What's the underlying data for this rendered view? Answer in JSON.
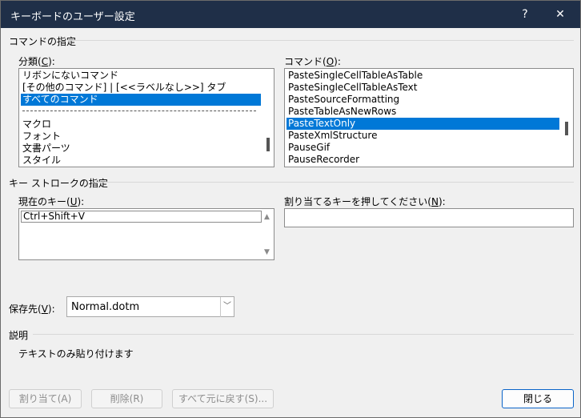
{
  "title": "キーボードのユーザー設定",
  "titlebar": {
    "help_label": "?",
    "close_label": "✕"
  },
  "command_group": "コマンドの指定",
  "categories": {
    "label_pre": "分類(",
    "label_key": "C",
    "label_post": "):",
    "items": [
      "リボンにないコマンド",
      "[その他のコマンド] | [<<ラベルなし>>] タブ",
      "すべてのコマンド",
      "マクロ",
      "フォント",
      "文書パーツ",
      "スタイル"
    ],
    "selected_index": 2
  },
  "commands": {
    "label_pre": "コマンド(",
    "label_key": "O",
    "label_post": "):",
    "items": [
      "PasteSingleCellTableAsTable",
      "PasteSingleCellTableAsText",
      "PasteSourceFormatting",
      "PasteTableAsNewRows",
      "PasteTextOnly",
      "PasteXmlStructure",
      "PauseGif",
      "PauseRecorder"
    ],
    "selected_index": 4
  },
  "keystroke_group": "キー ストロークの指定",
  "current_keys": {
    "label_pre": "現在のキー(",
    "label_key": "U",
    "label_post": "):",
    "items": [
      "Ctrl+Shift+V"
    ],
    "up_arrow": "▲",
    "down_arrow": "▼"
  },
  "new_key": {
    "label_pre": "割り当てるキーを押してください(",
    "label_key": "N",
    "label_post": "):",
    "value": ""
  },
  "save_in": {
    "label_pre": "保存先(",
    "label_key": "V",
    "label_post": "):",
    "value": "Normal.dotm",
    "chevron": "﹀"
  },
  "description": {
    "heading": "説明",
    "text": "テキストのみ貼り付けます"
  },
  "buttons": {
    "assign": "割り当て(A)",
    "remove": "削除(R)",
    "reset_all": "すべて元に戻す(S)...",
    "close": "閉じる"
  }
}
